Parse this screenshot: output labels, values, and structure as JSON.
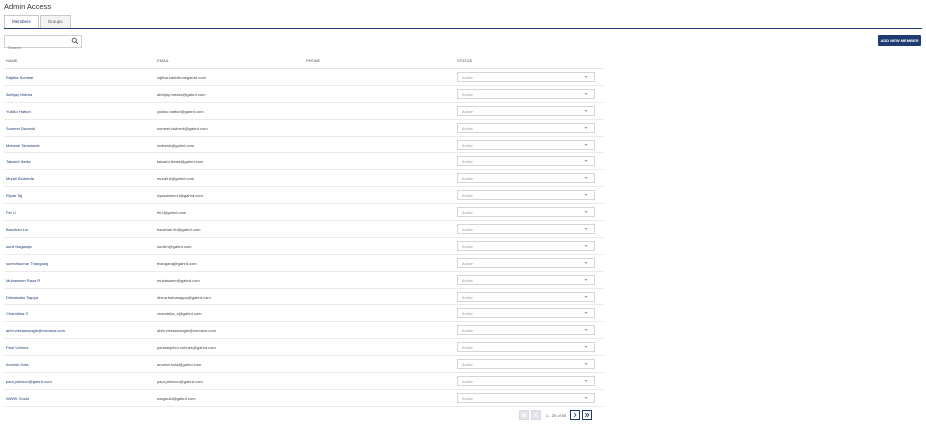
{
  "page": {
    "title": "Admin Access"
  },
  "tabs": [
    {
      "label": "Members",
      "active": true
    },
    {
      "label": "Groups",
      "active": false
    }
  ],
  "search": {
    "placeholder": "Search",
    "icon": "search-icon"
  },
  "actions": {
    "add_member_label": "ADD NEW MEMBER"
  },
  "table": {
    "columns": [
      "NAME",
      "EMAIL",
      "PHONE",
      "STATUS"
    ],
    "rows": [
      {
        "name": "Rajitha Kumbar",
        "email": "rajitha.kashikunegahrd.com",
        "phone": "",
        "status": "Active"
      },
      {
        "name": "Abhijay Mishra",
        "email": "abhijay.mishra@gahrd.com",
        "phone": "",
        "status": "Active"
      },
      {
        "name": "Yukiko Hattori",
        "email": "yukiko.hattori@gahrd.com",
        "phone": "",
        "status": "Active"
      },
      {
        "name": "Sumeet Dwivedi",
        "email": "sumeet.dwivedi@gahrd.com",
        "phone": "",
        "status": "Active"
      },
      {
        "name": "Mahesh Tamshade",
        "email": "mahesh@gahrd.com",
        "phone": "",
        "status": "Active"
      },
      {
        "name": "Takashi Ikeda",
        "email": "takashi.ikeda@gahrd.com",
        "phone": "",
        "status": "Active"
      },
      {
        "name": "Murali Boddeda",
        "email": "murali.b@gahrd.com",
        "phone": "",
        "status": "Active"
      },
      {
        "name": "Riyas Taj",
        "email": "riyasahmed.t@gahrd.com",
        "phone": "",
        "status": "Active"
      },
      {
        "name": "Fei Li",
        "email": "fei.l@gahrd.com",
        "phone": "",
        "status": "Active"
      },
      {
        "name": "Baozhan Liu",
        "email": "baozhan.liu@gahrd.com",
        "phone": "",
        "status": "Active"
      },
      {
        "name": "sunil Nagaraja",
        "email": "sunilm@gahrd.com",
        "phone": "",
        "status": "Active"
      },
      {
        "name": "sureshkumar Thangaraj",
        "email": "thangaraj@gahrd.com",
        "phone": "",
        "status": "Active"
      },
      {
        "name": "Mubasseer Raza R",
        "email": "mubasseer@gahrd.com",
        "phone": "",
        "status": "Active"
      },
      {
        "name": "Dhinababu Sappa",
        "email": "dhina.babusappa@gahrd.com",
        "phone": "",
        "status": "Active"
      },
      {
        "name": "Chandrika S",
        "email": "chandrika_s@gahrd.com",
        "phone": "",
        "status": "Active"
      },
      {
        "name": "abhi.vieslamangle@mendos.com",
        "email": "abhi.vieslamangle@mendos.com",
        "phone": "",
        "status": "Active"
      },
      {
        "name": "Paul Vohnes",
        "email": "paulstephen.vohnes@gahrd.com",
        "phone": "",
        "status": "Active"
      },
      {
        "name": "Anvesh Kola",
        "email": "anvesh.kola@gahrd.com",
        "phone": "",
        "status": "Active"
      },
      {
        "name": "paul.johnson@gahrd.com",
        "email": "paul.johnson@gahrd.com",
        "phone": "",
        "status": "Active"
      },
      {
        "name": "WWW Gould",
        "email": "wwgould@gahrd.com",
        "phone": "",
        "status": "Active"
      }
    ]
  },
  "pagination": {
    "range_text": "1 - 20 of 50"
  },
  "colors": {
    "accent": "#1f3b73",
    "text": "#333333",
    "muted": "#999999"
  }
}
